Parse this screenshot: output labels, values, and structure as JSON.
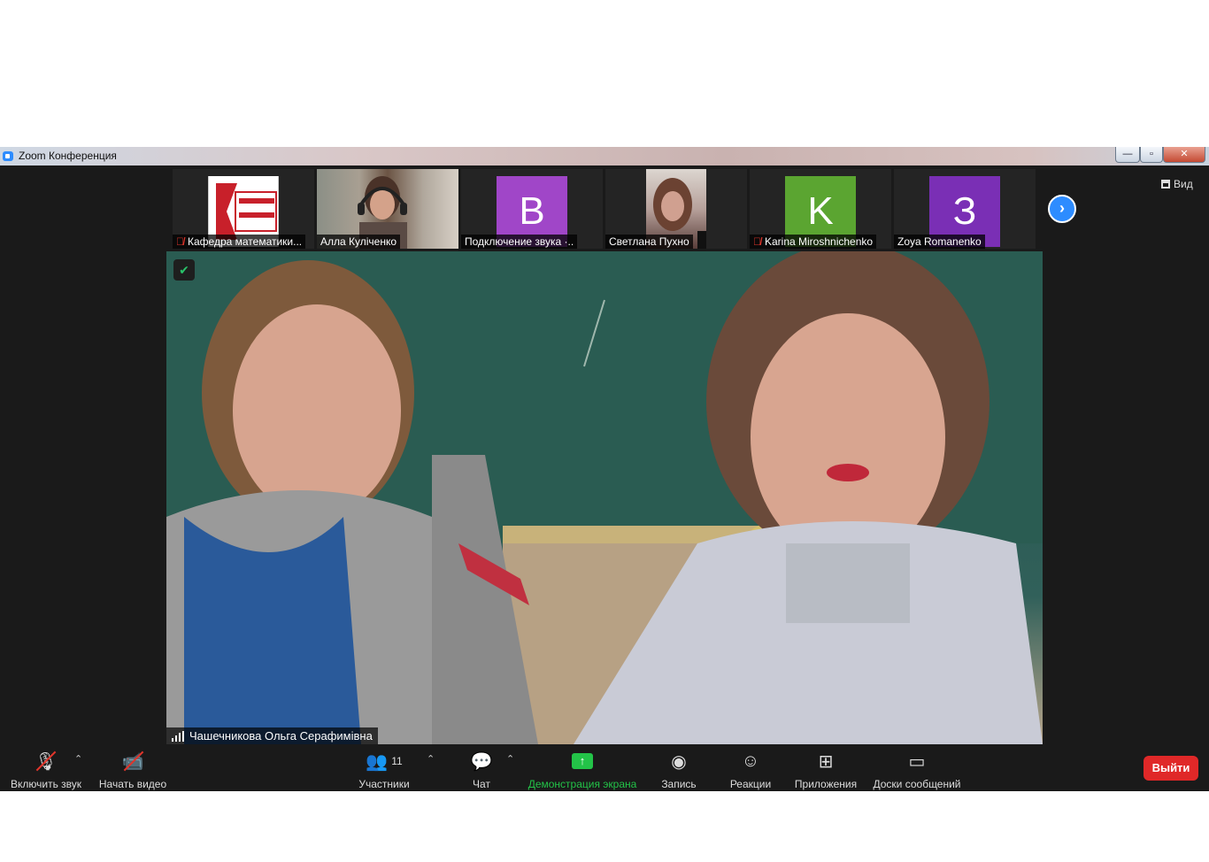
{
  "window": {
    "title": "Zoom Конференция",
    "minimize_icon": "minimize-icon",
    "maximize_icon": "maximize-icon",
    "close_icon": "close-icon"
  },
  "view_button": {
    "label": "Вид",
    "icon": "grid-icon"
  },
  "participants_strip": [
    {
      "name": "Кафедра математики...",
      "muted": true,
      "avatar_type": "logo",
      "avatar_text": "Кафедра математ"
    },
    {
      "name": "Алла Куліченко",
      "muted": false,
      "avatar_type": "video"
    },
    {
      "name": "Подключение звука ·..",
      "muted": false,
      "avatar_type": "letter",
      "letter": "В",
      "color": "#a046c8"
    },
    {
      "name": "Светлана Пухно",
      "muted": false,
      "avatar_type": "video"
    },
    {
      "name": "Karina Miroshnichenko",
      "muted": true,
      "avatar_type": "letter",
      "letter": "K",
      "color": "#5ba531"
    },
    {
      "name": "Zoya Romanenko",
      "muted": false,
      "avatar_type": "letter",
      "letter": "З",
      "color": "#7a2fb5"
    }
  ],
  "main_video": {
    "speaker_name": "Чашечникова Ольга Серафимівна",
    "encryption_icon": "shield-check-icon"
  },
  "toolbar": {
    "audio": {
      "label": "Включить звук",
      "icon": "microphone-muted-icon"
    },
    "video": {
      "label": "Начать видео",
      "icon": "camera-off-icon"
    },
    "participants": {
      "label": "Участники",
      "count": "11",
      "icon": "participants-icon"
    },
    "chat": {
      "label": "Чат",
      "icon": "chat-icon"
    },
    "share": {
      "label": "Демонстрация экрана",
      "icon": "share-screen-icon",
      "color": "#23c348"
    },
    "record": {
      "label": "Запись",
      "icon": "record-icon"
    },
    "reactions": {
      "label": "Реакции",
      "icon": "reactions-icon"
    },
    "apps": {
      "label": "Приложения",
      "icon": "apps-icon"
    },
    "whiteboards": {
      "label": "Доски сообщений",
      "icon": "whiteboard-icon"
    },
    "leave": {
      "label": "Выйти",
      "color": "#e02828"
    }
  }
}
